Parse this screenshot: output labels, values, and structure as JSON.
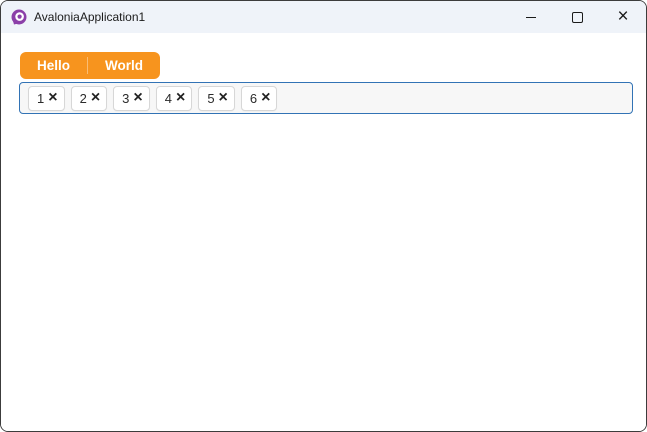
{
  "window": {
    "title": "AvaloniaApplication1",
    "icon": "avalonia-logo",
    "controls": {
      "minimize": "minimize",
      "maximize": "maximize",
      "close": "×"
    }
  },
  "toolbar": {
    "buttons": [
      {
        "label": "Hello"
      },
      {
        "label": "World"
      }
    ]
  },
  "chips": {
    "items": [
      {
        "label": "1"
      },
      {
        "label": "2"
      },
      {
        "label": "3"
      },
      {
        "label": "4"
      },
      {
        "label": "5"
      },
      {
        "label": "6"
      }
    ],
    "close_glyph": "×"
  },
  "colors": {
    "accent_orange": "#f7941e",
    "focus_border_blue": "#3273b5",
    "titlebar_bg": "#eff3f9",
    "window_border": "#3c3c3c",
    "logo_purple": "#8b3fa8"
  }
}
